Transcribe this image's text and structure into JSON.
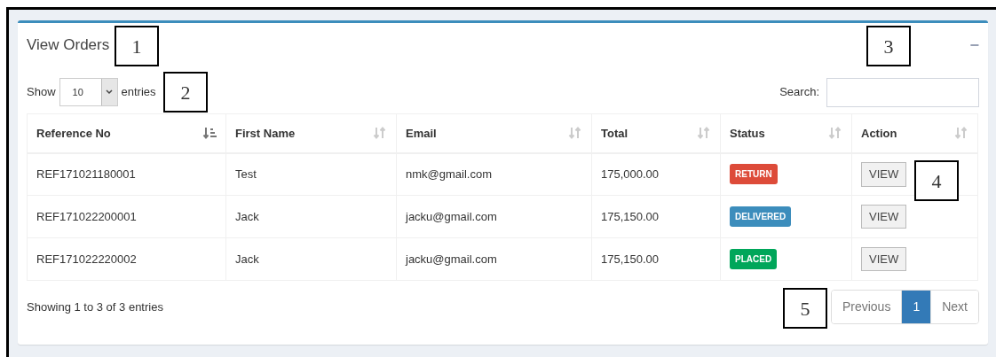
{
  "panel": {
    "title": "View Orders",
    "collapse_icon": "−"
  },
  "length_control": {
    "prefix": "Show",
    "value": "10",
    "suffix": "entries"
  },
  "search": {
    "label": "Search:"
  },
  "table": {
    "columns": [
      {
        "label": "Reference No",
        "sorted": true
      },
      {
        "label": "First Name",
        "sorted": false
      },
      {
        "label": "Email",
        "sorted": false
      },
      {
        "label": "Total",
        "sorted": false
      },
      {
        "label": "Status",
        "sorted": false
      },
      {
        "label": "Action",
        "sorted": false
      }
    ],
    "rows": [
      {
        "reference": "REF171021180001",
        "first_name": "Test",
        "email": "nmk@gmail.com",
        "total": "175,000.00",
        "status": {
          "label": "RETURN",
          "color": "#dd4b39"
        },
        "action": "VIEW"
      },
      {
        "reference": "REF171022200001",
        "first_name": "Jack",
        "email": "jacku@gmail.com",
        "total": "175,150.00",
        "status": {
          "label": "DELIVERED",
          "color": "#3c8dbc"
        },
        "action": "VIEW"
      },
      {
        "reference": "REF171022220002",
        "first_name": "Jack",
        "email": "jacku@gmail.com",
        "total": "175,150.00",
        "status": {
          "label": "PLACED",
          "color": "#00a65a"
        },
        "action": "VIEW"
      }
    ]
  },
  "info": "Showing 1 to 3 of 3 entries",
  "pagination": [
    {
      "label": "Previous",
      "selected": false
    },
    {
      "label": "1",
      "selected": true
    },
    {
      "label": "Next",
      "selected": false
    }
  ],
  "callouts": [
    "1",
    "2",
    "3",
    "4",
    "5"
  ]
}
